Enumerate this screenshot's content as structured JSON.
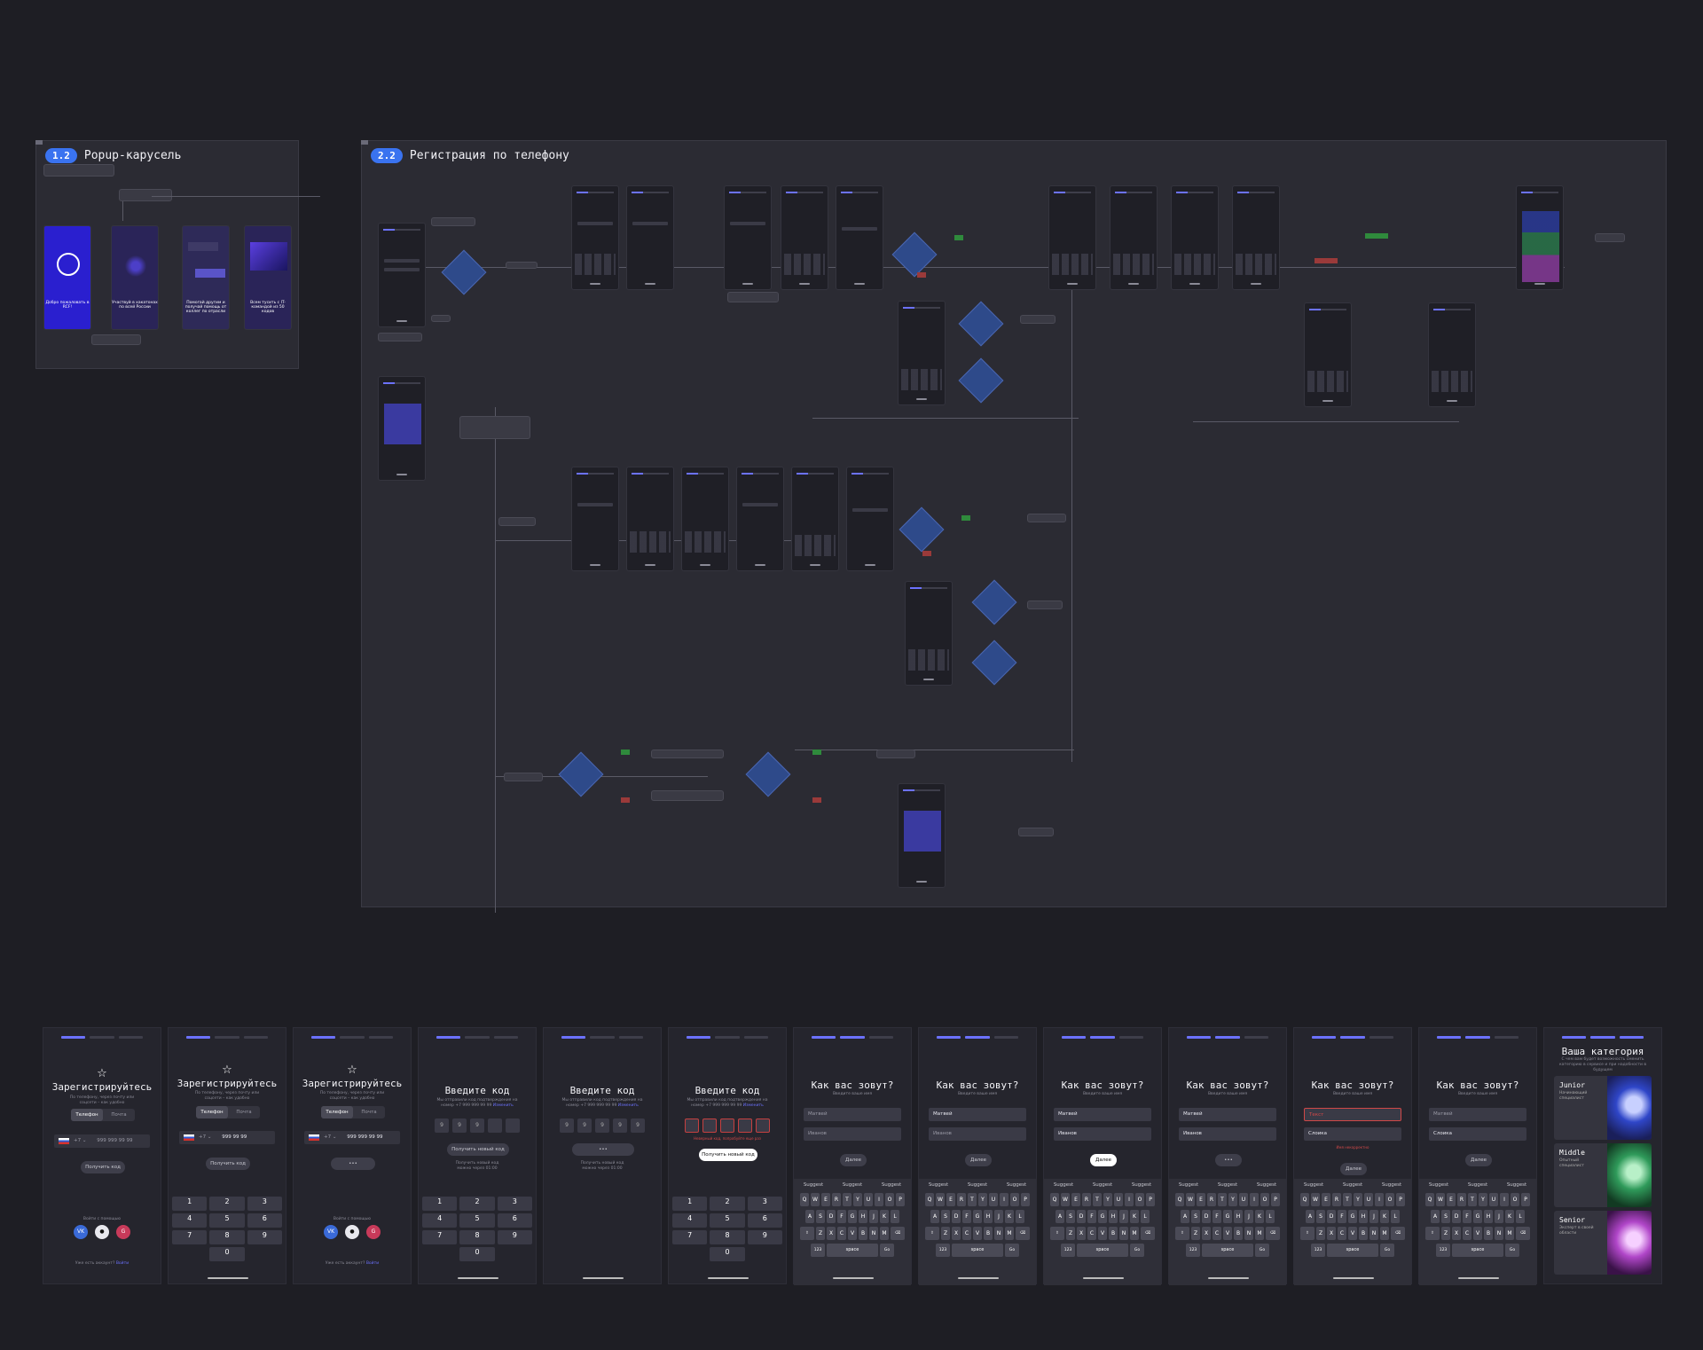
{
  "frame_popup": {
    "badge": "1.2",
    "title": "Popup-карусель",
    "slides": [
      {
        "text": "Добро пожаловать в RCF!",
        "color": "#2a1fcf"
      },
      {
        "text": "Участвуй в хакатонах по всей России",
        "color": "#2a2458"
      },
      {
        "text": "Помогай другим и получай помощь от коллег по отрасли",
        "color": "#2e2a58"
      },
      {
        "text": "Всем тусить с IT-командой из 50 кодов",
        "color": "#2a2458"
      }
    ]
  },
  "frame_phone_reg": {
    "badge": "2.2",
    "title": "Регистрация по телефону"
  },
  "colors": {
    "accent": "#6c72ff",
    "diamond": "#2e4a8a",
    "yes": "#2f8a3c",
    "no": "#9a3a3a"
  },
  "screens": [
    {
      "type": "register",
      "title": "Зарегистрируйтесь",
      "subtitle": "По телефону, через почту или соцсети – как удобно",
      "tab_phone": "Телефон",
      "tab_mail": "Почта",
      "phone_code": "+7",
      "phone_placeholder": "999 999 99 99",
      "button": "Получить код",
      "alt_login": "Войти с помощью",
      "footer_question": "Уже есть аккаунт?",
      "footer_link": "Войти"
    },
    {
      "type": "register-keypad",
      "title": "Зарегистрируйтесь",
      "subtitle": "По телефону, через почту или соцсети – как удобно",
      "tab_phone": "Телефон",
      "tab_mail": "Почта",
      "phone_code": "+7",
      "phone_value": "999 99 99",
      "button": "Получить код"
    },
    {
      "type": "register-loading",
      "title": "Зарегистрируйтесь",
      "subtitle": "По телефону, через почту или соцсети – как удобно",
      "tab_phone": "Телефон",
      "tab_mail": "Почта",
      "phone_code": "+7",
      "phone_value": "999 999 99 99",
      "button": "•••",
      "alt_login": "Войти с помощью",
      "footer_question": "Уже есть аккаунт?",
      "footer_link": "Войти"
    },
    {
      "type": "code-keypad",
      "title": "Введите код",
      "subtitle": "Мы отправили код подтверждения на номер +7 999 999 99 99",
      "subtitle_link": "Изменить",
      "digits": [
        "9",
        "9",
        "9",
        "",
        ""
      ],
      "button": "Получить новый код",
      "resend": "Получить новый код можно через 01:00"
    },
    {
      "type": "code-loading",
      "title": "Введите код",
      "subtitle": "Мы отправили код подтверждения на номер +7 999 999 99 99",
      "subtitle_link": "Изменить",
      "digits": [
        "9",
        "9",
        "9",
        "9",
        "9"
      ],
      "button": "•••",
      "resend": "Получить новый код можно через 01:00"
    },
    {
      "type": "code-error",
      "title": "Введите код",
      "subtitle": "Мы отправили код подтверждения на номер +7 999 999 99 99",
      "subtitle_link": "Изменить",
      "digits": [
        "",
        "",
        "",
        "",
        ""
      ],
      "error": "Неверный код, попробуйте еще раз",
      "button": "Получить новый код"
    },
    {
      "type": "name",
      "title": "Как вас зовут?",
      "subtitle": "Введите ваше имя",
      "first": "Матвей",
      "last": "Иванов",
      "button": "Далее",
      "filled": false
    },
    {
      "type": "name",
      "title": "Как вас зовут?",
      "subtitle": "Введите ваше имя",
      "first": "Матвей",
      "last": "Иванов",
      "button": "Далее",
      "filled": "first"
    },
    {
      "type": "name",
      "title": "Как вас зовут?",
      "subtitle": "Введите ваше имя",
      "first": "Матвей",
      "last": "Иванов",
      "button": "Далее",
      "filled": "both",
      "white": true
    },
    {
      "type": "name",
      "title": "Как вас зовут?",
      "subtitle": "Введите ваше имя",
      "first": "Матвей",
      "last": "Иванов",
      "button": "•••",
      "filled": "both"
    },
    {
      "type": "name-error",
      "title": "Как вас зовут?",
      "subtitle": "Введите ваше имя",
      "first": "Текст",
      "last": "Слоика",
      "error": "Имя некорректно",
      "button": "Далее"
    },
    {
      "type": "name",
      "title": "Как вас зовут?",
      "subtitle": "Введите ваше имя",
      "first": "Матвей",
      "last": "Слоика",
      "button": "Далее",
      "filled": "last"
    },
    {
      "type": "category",
      "title": "Ваша категория",
      "subtitle": "С чем вам будет возможность сменить категорию в сервисе и при надобности в будущем",
      "cards": [
        {
          "name": "Junior",
          "desc": "Начинающий специалист",
          "color": "#2f46c8"
        },
        {
          "name": "Middle",
          "desc": "Опытный специалист",
          "color": "#2f9a5a"
        },
        {
          "name": "Senior",
          "desc": "Эксперт в своей области",
          "color": "#b046c8"
        }
      ]
    }
  ],
  "keyboard": {
    "suggest": "Suggest",
    "row1": [
      "Q",
      "W",
      "E",
      "R",
      "T",
      "Y",
      "U",
      "I",
      "O",
      "P"
    ],
    "row2": [
      "A",
      "S",
      "D",
      "F",
      "G",
      "H",
      "J",
      "K",
      "L"
    ],
    "row3": [
      "Z",
      "X",
      "C",
      "V",
      "B",
      "N",
      "M"
    ],
    "num": "123",
    "space": "space",
    "go": "Go"
  },
  "numpad": [
    "1",
    "2",
    "3",
    "4",
    "5",
    "6",
    "7",
    "8",
    "9",
    "",
    "0",
    ""
  ],
  "social": [
    "VK",
    "",
    "G"
  ]
}
